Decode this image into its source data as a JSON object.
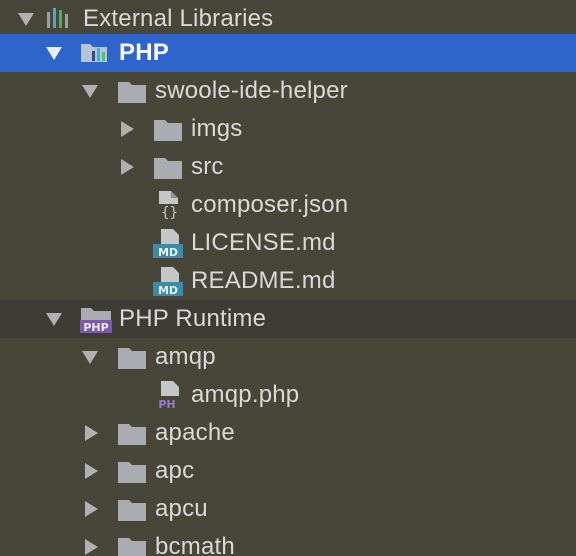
{
  "tree": {
    "root": {
      "label": "External Libraries",
      "icon": "library-bars-icon"
    },
    "php": {
      "label": "PHP",
      "icon": "php-library-folder-icon"
    },
    "swoole": {
      "label": "swoole-ide-helper",
      "icon": "folder-icon"
    },
    "imgs": {
      "label": "imgs",
      "icon": "folder-icon"
    },
    "src": {
      "label": "src",
      "icon": "folder-icon"
    },
    "composer": {
      "label": "composer.json",
      "icon": "json-file-icon"
    },
    "license": {
      "label": "LICENSE.md",
      "icon": "markdown-file-icon",
      "badge": "MD"
    },
    "readme": {
      "label": "README.md",
      "icon": "markdown-file-icon",
      "badge": "MD"
    },
    "runtime": {
      "label": "PHP Runtime",
      "icon": "php-runtime-folder-icon",
      "badge": "PHP"
    },
    "amqp": {
      "label": "amqp",
      "icon": "folder-icon"
    },
    "amqp_php": {
      "label": "amqp.php",
      "icon": "php-file-icon",
      "badge": "PH"
    },
    "apache": {
      "label": "apache",
      "icon": "folder-icon"
    },
    "apc": {
      "label": "apc",
      "icon": "folder-icon"
    },
    "apcu": {
      "label": "apcu",
      "icon": "folder-icon"
    },
    "bcmath": {
      "label": "bcmath",
      "icon": "folder-icon"
    }
  },
  "colors": {
    "background": "#484539",
    "selected": "#2f65ca",
    "group_row": "#3d3c35",
    "text": "#d9d9d9",
    "folder": "#a9adb1",
    "md_badge": "#3a8ca8",
    "php_badge": "#7b5aa6"
  }
}
